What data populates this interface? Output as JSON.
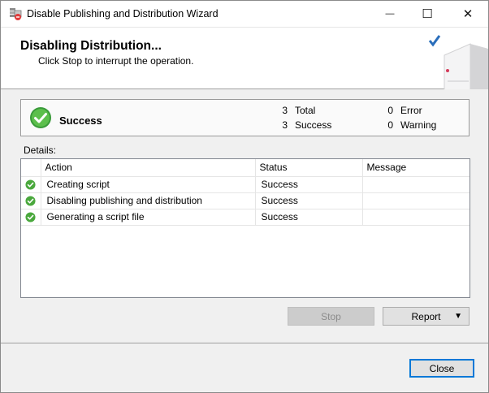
{
  "window": {
    "title": "Disable Publishing and Distribution Wizard",
    "minimize_glyph": "—",
    "maximize_glyph": "☐",
    "close_glyph": "✕"
  },
  "banner": {
    "title": "Disabling Distribution...",
    "subtitle": "Click Stop to interrupt the operation."
  },
  "status": {
    "label": "Success",
    "total_count": "3",
    "total_label": "Total",
    "success_count": "3",
    "success_label": "Success",
    "error_count": "0",
    "error_label": "Error",
    "warning_count": "0",
    "warning_label": "Warning"
  },
  "details": {
    "label": "Details:",
    "columns": [
      "Action",
      "Status",
      "Message"
    ],
    "rows": [
      {
        "action": "Creating script",
        "status": "Success",
        "message": ""
      },
      {
        "action": "Disabling publishing and distribution",
        "status": "Success",
        "message": ""
      },
      {
        "action": "Generating a script file",
        "status": "Success",
        "message": ""
      }
    ]
  },
  "buttons": {
    "stop": "Stop",
    "report": "Report",
    "close": "Close"
  },
  "icons": {
    "title": "wizard-db-icon",
    "success": "check-circle-icon",
    "banner": "server-check-icon"
  },
  "colors": {
    "success_green": "#4caf50",
    "accent_blue": "#0078d7"
  }
}
